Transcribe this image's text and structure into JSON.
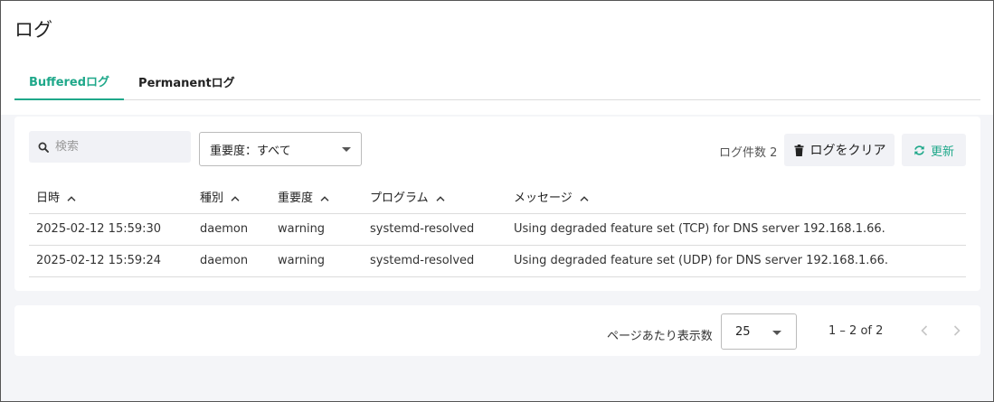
{
  "page": {
    "title": "ログ"
  },
  "tabs": [
    {
      "label": "Bufferedログ",
      "active": true
    },
    {
      "label": "Permanentログ",
      "active": false
    }
  ],
  "filters": {
    "search_placeholder": "検索",
    "search_value": "",
    "severity_label": "重要度：すべて"
  },
  "toolbar": {
    "log_count_text": "ログ件数 2",
    "clear_label": "ログをクリア",
    "refresh_label": "更新"
  },
  "table": {
    "headers": [
      "日時",
      "種別",
      "重要度",
      "プログラム",
      "メッセージ"
    ],
    "rows": [
      [
        "2025-02-12 15:59:30",
        "daemon",
        "warning",
        "systemd-resolved",
        "Using degraded feature set (TCP) for DNS server 192.168.1.66."
      ],
      [
        "2025-02-12 15:59:24",
        "daemon",
        "warning",
        "systemd-resolved",
        "Using degraded feature set (UDP) for DNS server 192.168.1.66."
      ]
    ]
  },
  "pagination": {
    "per_page_label": "ページあたり表示数",
    "per_page_value": "25",
    "range_text": "1 – 2 of 2"
  },
  "colors": {
    "accent": "#1fa88a",
    "background": "#f4f5f8"
  }
}
